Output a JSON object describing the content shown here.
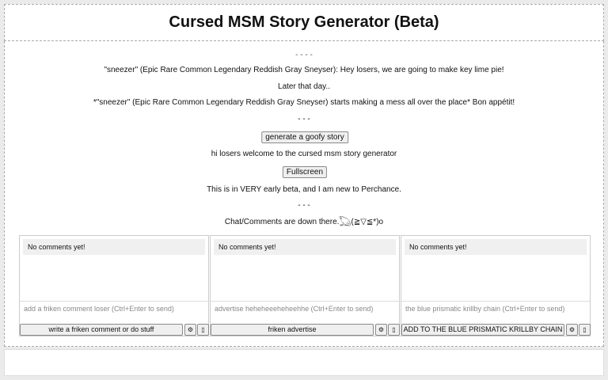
{
  "title": "Cursed MSM Story Generator (Beta)",
  "story": {
    "divider_top": "- - - -",
    "line1": "\"sneezer\" (Epic Rare Common Legendary Reddish Gray Sneyser): Hey losers, we are going to make key lime pie!",
    "line2": "Later that day..",
    "line3": "*\"sneezer\" (Epic Rare Common Legendary Reddish Gray Sneyser) starts making a mess all over the place* Bon appétit!",
    "divider_bottom": "- - -"
  },
  "generate_button": "generate a goofy story",
  "welcome_text": "hi losers welcome to the cursed msm story generator",
  "fullscreen_button": "Fullscreen",
  "beta_text": "This is in VERY early beta, and I am new to Perchance.",
  "divider_mid": "- - -",
  "chat_text": "Chat/Comments are down there.𓆏(≧▽≦*)o",
  "panels": [
    {
      "empty_text": "No comments yet!",
      "placeholder": "add a friken comment loser (Ctrl+Enter to send)",
      "submit_label": "write a friken comment or do stuff",
      "settings_icon": "⚙",
      "menu_icon": "▯"
    },
    {
      "empty_text": "No comments yet!",
      "placeholder": "advertise heheheeeheheehhe (Ctrl+Enter to send)",
      "submit_label": "friken advertise",
      "settings_icon": "⚙",
      "menu_icon": "▯"
    },
    {
      "empty_text": "No comments yet!",
      "placeholder": "the blue prismatic krillby chain (Ctrl+Enter to send)",
      "submit_label": "ADD TO THE BLUE PRISMATIC KRILLBY CHAIN",
      "settings_icon": "⚙",
      "menu_icon": "▯"
    }
  ]
}
